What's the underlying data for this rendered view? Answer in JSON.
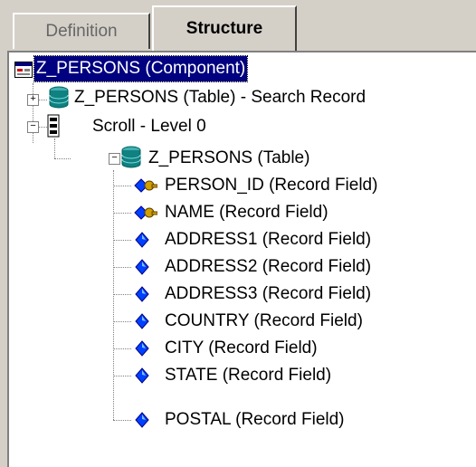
{
  "tabs": {
    "definition": "Definition",
    "structure": "Structure"
  },
  "tree": {
    "root": "Z_PERSONS (Component)",
    "search_record": "Z_PERSONS (Table) - Search Record",
    "scroll": "Scroll - Level 0",
    "table": "Z_PERSONS (Table)",
    "fields": [
      "PERSON_ID (Record Field)",
      "NAME (Record Field)",
      "ADDRESS1 (Record Field)",
      "ADDRESS2 (Record Field)",
      "ADDRESS3 (Record Field)",
      "COUNTRY (Record Field)",
      "CITY (Record Field)",
      "STATE (Record Field)",
      "POSTAL (Record Field)"
    ],
    "expander_collapsed": "+",
    "expander_expanded": "−"
  },
  "icons": {
    "component": "component-icon",
    "table": "database-table-icon",
    "scroll": "scroll-icon",
    "key_field": "key-field-icon",
    "field": "field-diamond-icon"
  },
  "colors": {
    "selection": "#000080",
    "diamond": "#0000ff",
    "key": "#b08800"
  }
}
